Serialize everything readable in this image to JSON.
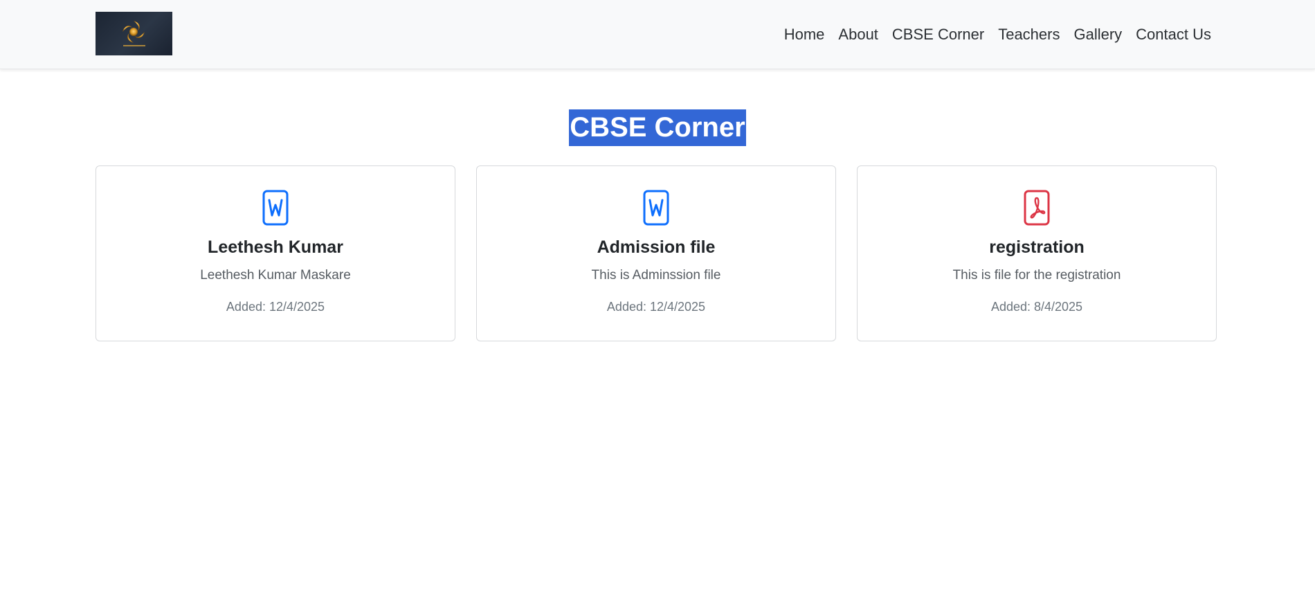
{
  "nav": {
    "links": [
      {
        "label": "Home"
      },
      {
        "label": "About"
      },
      {
        "label": "CBSE Corner"
      },
      {
        "label": "Teachers"
      },
      {
        "label": "Gallery"
      },
      {
        "label": "Contact Us"
      }
    ]
  },
  "page": {
    "title": "CBSE Corner",
    "title_highlight_color": "#3367d6"
  },
  "files": [
    {
      "icon": "word-file-icon",
      "icon_color": "#0d6efd",
      "title": "Leethesh Kumar",
      "description": "Leethesh Kumar Maskare",
      "added": "Added: 12/4/2025"
    },
    {
      "icon": "word-file-icon",
      "icon_color": "#0d6efd",
      "title": "Admission file",
      "description": "This is Adminssion file",
      "added": "Added: 12/4/2025"
    },
    {
      "icon": "pdf-file-icon",
      "icon_color": "#dc3545",
      "title": "registration",
      "description": "This is file for the registration",
      "added": "Added: 8/4/2025"
    }
  ]
}
